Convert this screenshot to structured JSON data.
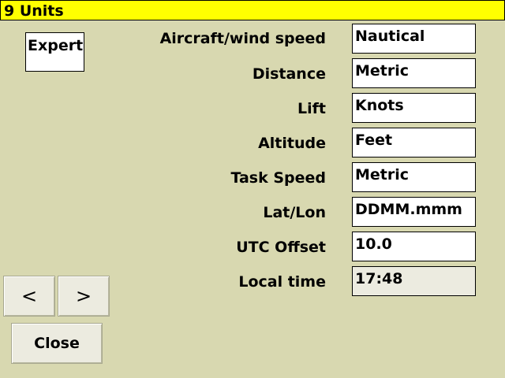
{
  "window": {
    "title": "9 Units"
  },
  "mode_button": {
    "label": "Expert"
  },
  "settings": [
    {
      "label": "Aircraft/wind speed",
      "value": "Nautical",
      "editable": true
    },
    {
      "label": "Distance",
      "value": "Metric",
      "editable": true
    },
    {
      "label": "Lift",
      "value": "Knots",
      "editable": true
    },
    {
      "label": "Altitude",
      "value": "Feet",
      "editable": true
    },
    {
      "label": "Task Speed",
      "value": "Metric",
      "editable": true
    },
    {
      "label": "Lat/Lon",
      "value": "DDMM.mmm",
      "editable": true
    },
    {
      "label": "UTC Offset",
      "value": "10.0",
      "editable": true
    },
    {
      "label": "Local time",
      "value": "17:48",
      "editable": false
    }
  ],
  "navigation": {
    "prev_label": "<",
    "next_label": ">",
    "close_label": "Close"
  },
  "colors": {
    "background": "#d8d8b0",
    "title_bar": "#ffff00",
    "readonly_field": "#ecebe0",
    "button": "#ecebe0"
  }
}
